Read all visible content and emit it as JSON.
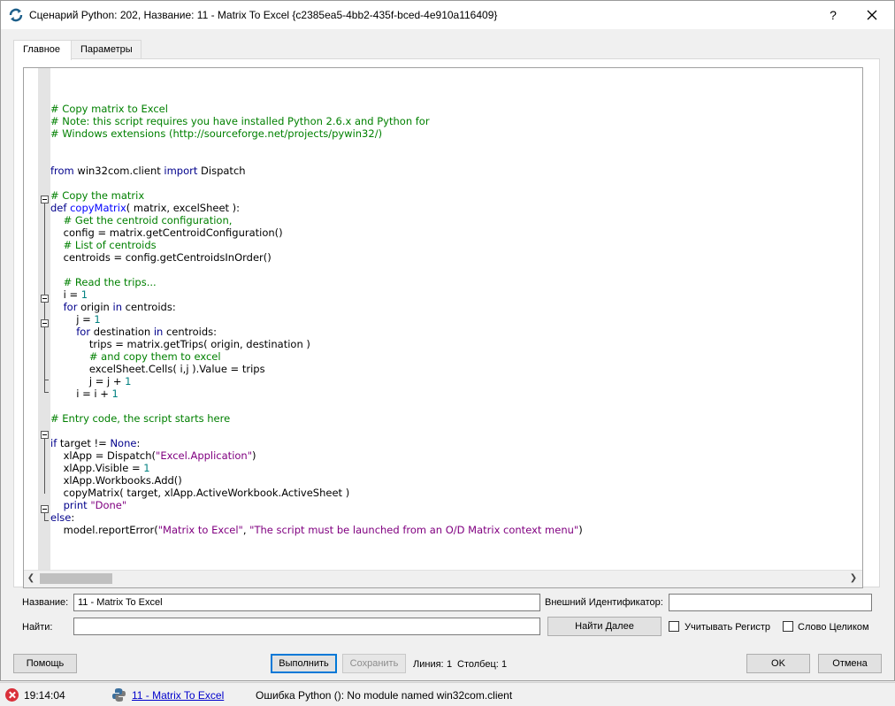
{
  "window": {
    "title": "Сценарий Python: 202, Название: 11 - Matrix To Excel  {c2385ea5-4bb2-435f-bced-4e910a116409}",
    "help_label": "?"
  },
  "tabs": [
    {
      "label": "Главное",
      "active": true
    },
    {
      "label": "Параметры",
      "active": false
    }
  ],
  "code_lines": [
    [],
    [
      {
        "t": "# Copy matrix to Excel",
        "c": "comment"
      }
    ],
    [
      {
        "t": "# Note: this script requires you have installed Python 2.6.x and Python for",
        "c": "comment"
      }
    ],
    [
      {
        "t": "# Windows extensions (http://sourceforge.net/projects/pywin32/)",
        "c": "comment"
      }
    ],
    [],
    [],
    [
      {
        "t": "from",
        "c": "kw"
      },
      {
        "t": " win32com.client "
      },
      {
        "t": "import",
        "c": "kw"
      },
      {
        "t": " Dispatch"
      }
    ],
    [],
    [
      {
        "t": "# Copy the matrix",
        "c": "comment"
      }
    ],
    [
      {
        "t": "def ",
        "c": "kw"
      },
      {
        "t": "copyMatrix",
        "c": "fn"
      },
      {
        "t": "( matrix, excelSheet ):"
      }
    ],
    [
      {
        "t": "    # Get the centroid configuration,",
        "c": "comment"
      }
    ],
    [
      {
        "t": "    config = matrix.getCentroidConfiguration()"
      }
    ],
    [
      {
        "t": "    # List of centroids",
        "c": "comment"
      }
    ],
    [
      {
        "t": "    centroids = config.getCentroidsInOrder()"
      }
    ],
    [],
    [
      {
        "t": "    # Read the trips...",
        "c": "comment"
      }
    ],
    [
      {
        "t": "    i = "
      },
      {
        "t": "1",
        "c": "num"
      }
    ],
    [
      {
        "t": "    "
      },
      {
        "t": "for",
        "c": "kw"
      },
      {
        "t": " origin "
      },
      {
        "t": "in",
        "c": "kw"
      },
      {
        "t": " centroids:"
      }
    ],
    [
      {
        "t": "        j = "
      },
      {
        "t": "1",
        "c": "num"
      }
    ],
    [
      {
        "t": "        "
      },
      {
        "t": "for",
        "c": "kw"
      },
      {
        "t": " destination "
      },
      {
        "t": "in",
        "c": "kw"
      },
      {
        "t": " centroids:"
      }
    ],
    [
      {
        "t": "            trips = matrix.getTrips( origin, destination )"
      }
    ],
    [
      {
        "t": "            # and copy them to excel",
        "c": "comment"
      }
    ],
    [
      {
        "t": "            excelSheet.Cells( i,j ).Value = trips"
      }
    ],
    [
      {
        "t": "            j = j + "
      },
      {
        "t": "1",
        "c": "num"
      }
    ],
    [
      {
        "t": "        i = i + "
      },
      {
        "t": "1",
        "c": "num"
      }
    ],
    [],
    [
      {
        "t": "# Entry code, the script starts here",
        "c": "comment"
      }
    ],
    [],
    [
      {
        "t": "if",
        "c": "kw"
      },
      {
        "t": " target != "
      },
      {
        "t": "None",
        "c": "kw"
      },
      {
        "t": ":"
      }
    ],
    [
      {
        "t": "    xlApp = Dispatch("
      },
      {
        "t": "\"Excel.Application\"",
        "c": "str"
      },
      {
        "t": ")"
      }
    ],
    [
      {
        "t": "    xlApp.Visible = "
      },
      {
        "t": "1",
        "c": "num"
      }
    ],
    [
      {
        "t": "    xlApp.Workbooks.Add()"
      }
    ],
    [
      {
        "t": "    copyMatrix( target, xlApp.ActiveWorkbook.ActiveSheet )"
      }
    ],
    [
      {
        "t": "    "
      },
      {
        "t": "print",
        "c": "kw"
      },
      {
        "t": " "
      },
      {
        "t": "\"Done\"",
        "c": "str"
      }
    ],
    [
      {
        "t": "else",
        "c": "kw"
      },
      {
        "t": ":"
      }
    ],
    [
      {
        "t": "    model.reportError("
      },
      {
        "t": "\"Matrix to Excel\"",
        "c": "str"
      },
      {
        "t": ", "
      },
      {
        "t": "\"The script must be launched from an O/D Matrix context menu\"",
        "c": "str"
      },
      {
        "t": ")"
      }
    ]
  ],
  "form": {
    "name_label": "Название:",
    "name_value": "11 - Matrix To Excel",
    "ext_id_label": "Внешний Идентификатор:",
    "ext_id_value": "",
    "find_label": "Найти:",
    "find_value": "",
    "find_next_button": "Найти Далее",
    "match_case_label": "Учитывать Регистр",
    "match_case_checked": false,
    "whole_word_label": "Слово Целиком",
    "whole_word_checked": false
  },
  "footer": {
    "help_button": "Помощь",
    "run_button": "Выполнить",
    "save_button": "Сохранить",
    "line_label": "Линия:",
    "line_value": "1",
    "column_label": "Столбец:",
    "column_value": "1",
    "ok_button": "OK",
    "cancel_button": "Отмена"
  },
  "statusbar": {
    "time": "19:14:04",
    "link_text": "11 - Matrix To Excel",
    "message": "Ошибка Python (): No module named win32com.client"
  },
  "colors": {
    "comment": "#008000",
    "keyword": "#00008b",
    "function": "#0000ff",
    "string": "#800080",
    "number": "#008080",
    "error": "#d9303a"
  }
}
